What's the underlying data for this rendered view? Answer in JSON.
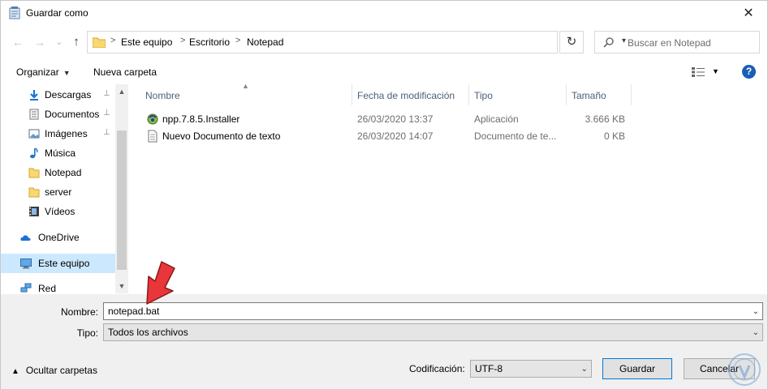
{
  "window": {
    "title": "Guardar como",
    "close_glyph": "✕"
  },
  "navigation": {
    "back_glyph": "←",
    "forward_glyph": "→",
    "recent_glyph": "⌄",
    "up_glyph": "↑",
    "breadcrumbs": [
      "Este equipo",
      "Escritorio",
      "Notepad"
    ],
    "separator_glyph": ">",
    "refresh_glyph": "↻"
  },
  "search": {
    "placeholder": "Buscar en Notepad"
  },
  "toolbar": {
    "organize": "Organizar",
    "new_folder": "Nueva carpeta",
    "help": "?"
  },
  "sidebar": {
    "items": [
      {
        "label": "Descargas",
        "icon": "download-icon",
        "pinned": true
      },
      {
        "label": "Documentos",
        "icon": "documents-icon",
        "pinned": true
      },
      {
        "label": "Imágenes",
        "icon": "pictures-icon",
        "pinned": true
      },
      {
        "label": "Música",
        "icon": "music-icon",
        "pinned": false
      },
      {
        "label": "Notepad",
        "icon": "folder-icon",
        "pinned": false
      },
      {
        "label": "server",
        "icon": "folder-icon",
        "pinned": false
      },
      {
        "label": "Vídeos",
        "icon": "videos-icon",
        "pinned": false
      },
      {
        "label": "OneDrive",
        "icon": "onedrive-icon",
        "pinned": false
      },
      {
        "label": "Este equipo",
        "icon": "computer-icon",
        "pinned": false,
        "selected": true
      },
      {
        "label": "Red",
        "icon": "network-icon",
        "pinned": false
      }
    ],
    "pin_glyph": "📌"
  },
  "file_list": {
    "columns": [
      "Nombre",
      "Fecha de modificación",
      "Tipo",
      "Tamaño"
    ],
    "rows": [
      {
        "name": "npp.7.8.5.Installer",
        "date": "26/03/2020 13:37",
        "type": "Aplicación",
        "size": "3.666 KB",
        "icon": "installer-icon"
      },
      {
        "name": "Nuevo Documento de texto",
        "date": "26/03/2020 14:07",
        "type": "Documento de te...",
        "size": "0 KB",
        "icon": "text-document-icon"
      }
    ]
  },
  "form": {
    "name_label": "Nombre:",
    "name_value": "notepad.bat",
    "type_label": "Tipo:",
    "type_value": "Todos los archivos",
    "encoding_label": "Codificación:",
    "encoding_value": "UTF-8"
  },
  "footer": {
    "hide_folders": "Ocultar carpetas",
    "save": "Guardar",
    "cancel": "Cancelar"
  },
  "colors": {
    "accent": "#0078d7",
    "selected_bg": "#cce8ff",
    "annotation_arrow": "#e8363a"
  }
}
